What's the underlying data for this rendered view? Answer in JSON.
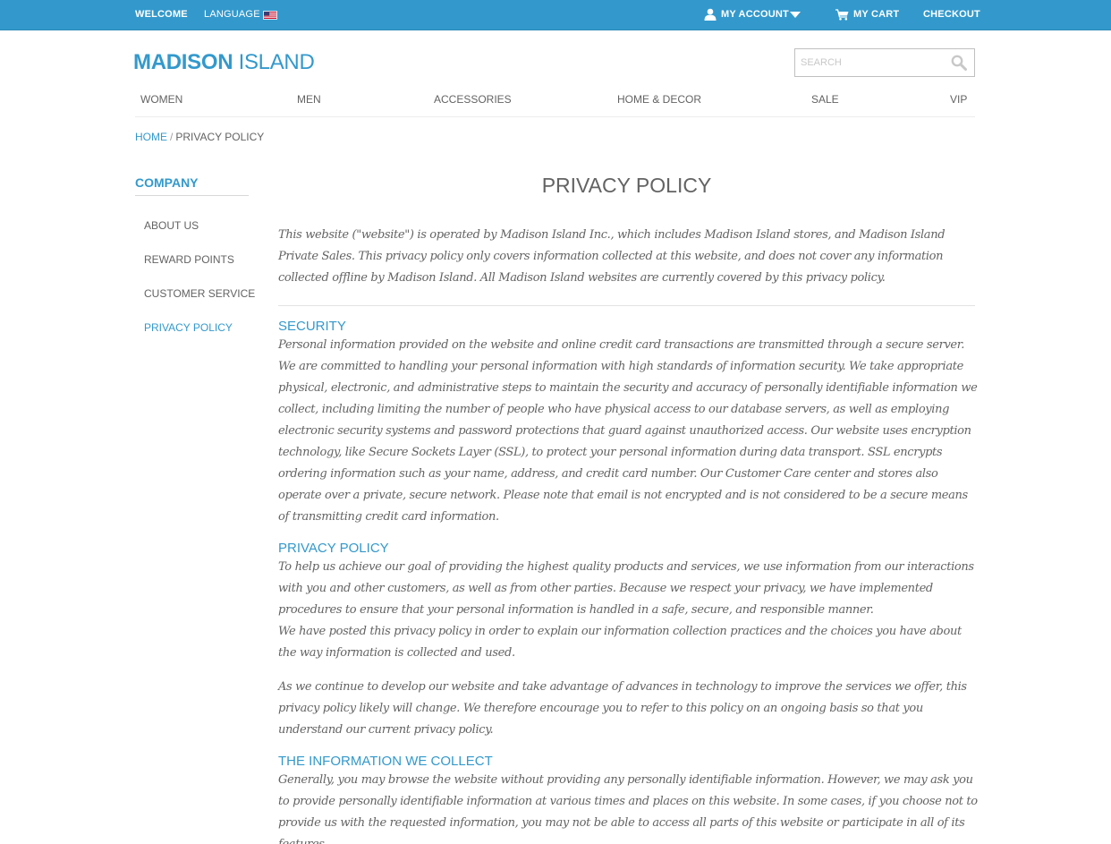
{
  "topbar": {
    "welcome": "WELCOME",
    "language": "LANGUAGE",
    "my_account": "MY ACCOUNT",
    "my_cart": "MY CART",
    "checkout": "CHECKOUT",
    "icons": [
      "us-flag-icon",
      "user-icon",
      "chevron-down-icon",
      "cart-icon"
    ]
  },
  "logo": {
    "strong": "MADISON",
    "light": " ISLAND"
  },
  "search": {
    "placeholder": "SEARCH",
    "value": ""
  },
  "nav": [
    "WOMEN",
    "MEN",
    "ACCESSORIES",
    "HOME & DECOR",
    "SALE",
    "VIP"
  ],
  "breadcrumb": {
    "home": "HOME",
    "separator": "/",
    "current": "PRIVACY POLICY"
  },
  "sidebar": {
    "title": "COMPANY",
    "items": [
      {
        "label": "ABOUT US",
        "active": false
      },
      {
        "label": "REWARD POINTS",
        "active": false
      },
      {
        "label": "CUSTOMER SERVICE",
        "active": false
      },
      {
        "label": "PRIVACY POLICY",
        "active": true
      }
    ]
  },
  "main": {
    "title": "PRIVACY POLICY",
    "intro": "This website (\"website\") is operated by Madison Island Inc., which includes Madison Island stores, and Madison Island Private Sales. This privacy policy only covers information collected at this website, and does not cover any information collected offline by Madison Island. All Madison Island websites are currently covered by this privacy policy.",
    "sections": [
      {
        "heading": "SECURITY",
        "paragraphs": [
          "Personal information provided on the website and online credit card transactions are transmitted through a secure server. We are committed to handling your personal information with high standards of information security. We take appropriate physical, electronic, and administrative steps to maintain the security and accuracy of personally identifiable information we collect, including limiting the number of people who have physical access to our database servers, as well as employing electronic security systems and password protections that guard against unauthorized access. Our website uses encryption technology, like Secure Sockets Layer (SSL), to protect your personal information during data transport. SSL encrypts ordering information such as your name, address, and credit card number. Our Customer Care center and stores also operate over a private, secure network. Please note that email is not encrypted and is not considered to be a secure means of transmitting credit card information."
        ]
      },
      {
        "heading": "PRIVACY POLICY",
        "paragraphs": [
          "To help us achieve our goal of providing the highest quality products and services, we use information from our interactions with you and other customers, as well as from other parties. Because we respect your privacy, we have implemented procedures to ensure that your personal information is handled in a safe, secure, and responsible manner.",
          "We have posted this privacy policy in order to explain our information collection practices and the choices you have about the way information is collected and used.",
          "As we continue to develop our website and take advantage of advances in technology to improve the services we offer, this privacy policy likely will change. We therefore encourage you to refer to this policy on an ongoing basis so that you understand our current privacy policy."
        ]
      },
      {
        "heading": "THE INFORMATION WE COLLECT",
        "paragraphs": [
          "Generally, you may browse the website without providing any personally identifiable information. However, we may ask you to provide personally identifiable information at various times and places on this website. In some cases, if you choose not to provide us with the requested information, you may not be able to access all parts of this website or participate in all of its features."
        ]
      }
    ]
  },
  "colors": {
    "accent": "#3399cc",
    "text": "#636363",
    "rule": "#ededed"
  }
}
